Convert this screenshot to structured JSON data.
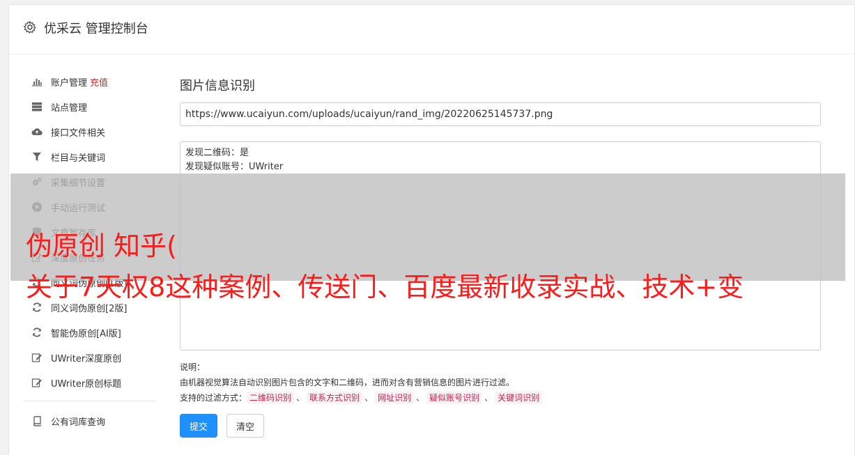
{
  "header": {
    "title": "优采云 管理控制台",
    "icon": "gear-icon"
  },
  "sidebar": {
    "items": [
      {
        "label": "账户管理",
        "badge": "充值",
        "icon": "bar-chart-icon"
      },
      {
        "label": "站点管理",
        "icon": "server-icon"
      },
      {
        "label": "接口文件相关",
        "icon": "cloud-upload-icon"
      },
      {
        "label": "栏目与关键词",
        "icon": "filter-icon"
      },
      {
        "label": "采集细节设置",
        "icon": "gears-icon"
      },
      {
        "label": "手动运行测试",
        "icon": "play-icon"
      },
      {
        "label": "文章暂存库",
        "icon": "database-icon"
      },
      {
        "label": "深度原创任务",
        "icon": "edit-icon"
      },
      {
        "label": "同义词伪原创[1版]",
        "icon": "refresh-icon"
      },
      {
        "label": "同义词伪原创[2版]",
        "icon": "refresh-icon"
      },
      {
        "label": "智能伪原创[AI版]",
        "icon": "refresh-icon"
      },
      {
        "label": "UWriter深度原创",
        "icon": "edit-icon"
      },
      {
        "label": "UWriter原创标题",
        "icon": "edit-icon"
      }
    ],
    "footer_items": [
      {
        "label": "公有词库查询",
        "icon": "book-icon"
      }
    ]
  },
  "main": {
    "title": "图片信息识别",
    "url_value": "https://www.ucaiyun.com/uploads/ucaiyun/rand_img/20220625145737.png",
    "result_lines": [
      "发现二维码：是",
      "发现疑似账号：UWriter"
    ],
    "desc_title": "说明：",
    "desc_text": "由机器视觉算法自动识别图片包含的文字和二维码，进而对含有营销信息的图片进行过滤。",
    "filter_label": "支持的过滤方式：",
    "filter_tags": [
      "二维码识别",
      "联系方式识别",
      "网址识别",
      "疑似账号识别",
      "关键词识别"
    ],
    "submit_label": "提交",
    "clear_label": "清空"
  },
  "overlay": {
    "line1": "伪原创 知乎(",
    "line2": "关于7天权8这种案例、传送门、百度最新收录实战、技术+变"
  }
}
